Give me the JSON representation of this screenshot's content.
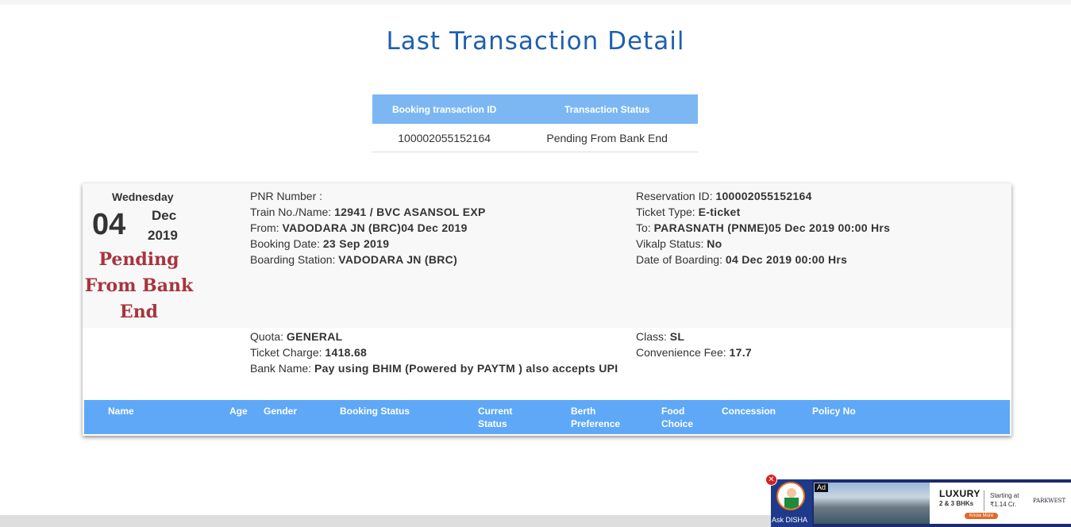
{
  "page_title": "Last Transaction Detail",
  "transaction_table": {
    "headers": [
      "Booking transaction ID",
      "Transaction Status"
    ],
    "row": {
      "id": "100002055152164",
      "status": "Pending From Bank End"
    }
  },
  "ticket": {
    "day_name": "Wednesday",
    "day_number": "04",
    "month": "Dec",
    "year": "2019",
    "status": "Pending From Bank End",
    "pnr": {
      "label": "PNR Number :",
      "value": ""
    },
    "train": {
      "label": "Train No./Name:",
      "value": "12941 / BVC ASANSOL EXP"
    },
    "from": {
      "label": "From:",
      "value": "VADODARA JN (BRC)04 Dec 2019"
    },
    "booking_date": {
      "label": "Booking Date:",
      "value": "23 Sep 2019"
    },
    "boarding_station": {
      "label": "Boarding Station:",
      "value": "VADODARA JN (BRC)"
    },
    "reservation_id": {
      "label": "Reservation ID:",
      "value": "100002055152164"
    },
    "ticket_type": {
      "label": "Ticket Type:",
      "value": "E-ticket"
    },
    "to": {
      "label": "To:",
      "value": "PARASNATH (PNME)05 Dec 2019 00:00 Hrs"
    },
    "vikalp": {
      "label": "Vikalp Status:",
      "value": "No"
    },
    "date_of_boarding": {
      "label": "Date of Boarding:",
      "value": "04 Dec 2019 00:00 Hrs"
    },
    "quota": {
      "label": "Quota:",
      "value": "GENERAL"
    },
    "ticket_charge": {
      "label": "Ticket Charge:",
      "value": "1418.68"
    },
    "bank_name": {
      "label": "Bank Name:",
      "value": "Pay using BHIM (Powered by PAYTM ) also accepts UPI"
    },
    "class": {
      "label": "Class:",
      "value": "SL"
    },
    "convenience_fee": {
      "label": "Convenience Fee:",
      "value": "17.7"
    }
  },
  "passenger_headers": {
    "name": "Name",
    "age": "Age",
    "gender": "Gender",
    "booking_status": "Booking Status",
    "current_status": "Current Status",
    "berth_preference": "Berth Preference",
    "food_choice": "Food Choice",
    "concession": "Concession",
    "policy_no": "Policy No"
  },
  "ad": {
    "disha_label": "Ask DISHA",
    "close_symbol": "✕",
    "tag": "Ad",
    "headline": "LUXURY",
    "sub": "2 & 3 BHKs",
    "price": "Starting at ₹1.14 Cr.",
    "cta": "Know More",
    "brand": "PARKWEST"
  }
}
